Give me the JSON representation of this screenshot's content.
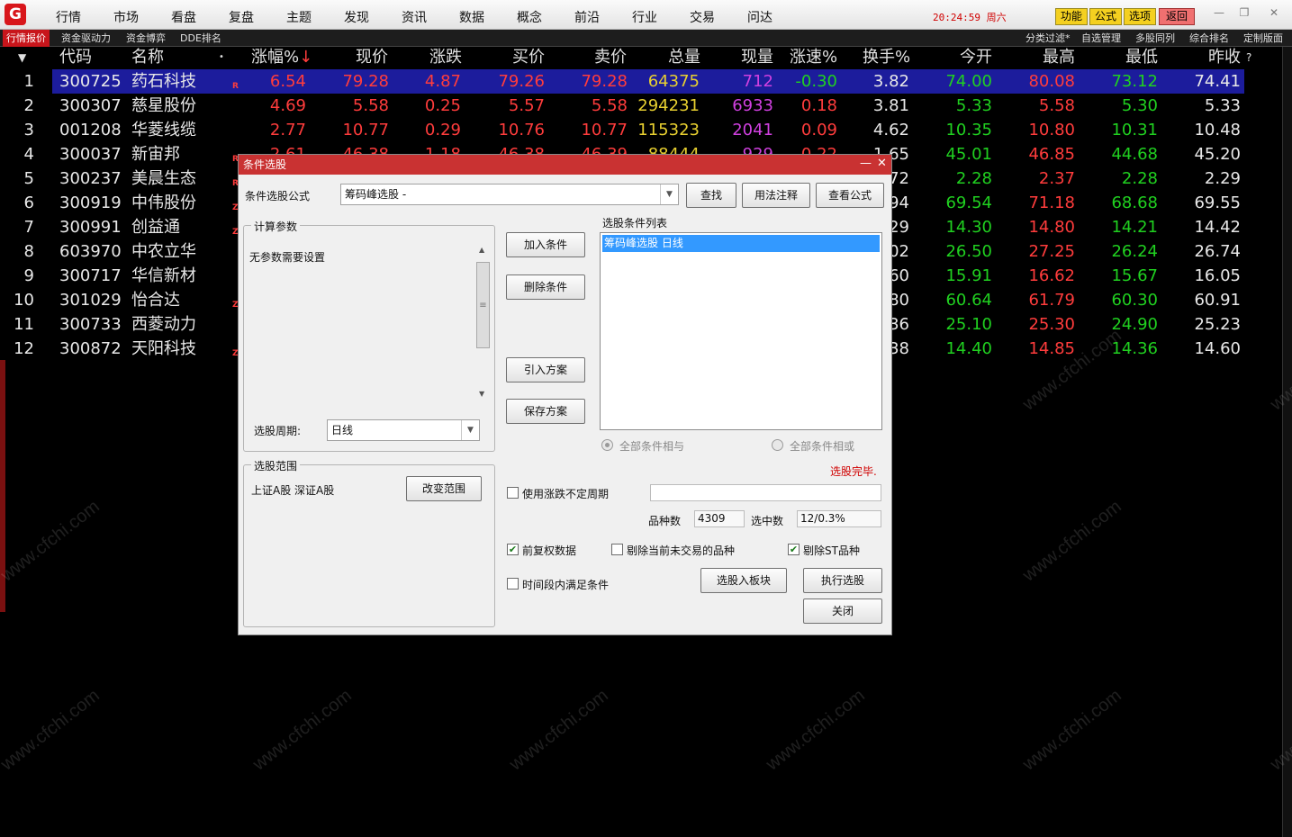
{
  "topbar": {
    "logo": "G",
    "menus": [
      "行情",
      "市场",
      "看盘",
      "复盘",
      "主题",
      "发现",
      "资讯",
      "数据",
      "概念",
      "前沿",
      "行业",
      "交易",
      "问达"
    ],
    "clock": "20:24:59 周六",
    "buttons": [
      {
        "label": "功能",
        "bg": "#f4d020"
      },
      {
        "label": "公式",
        "bg": "#f4d020"
      },
      {
        "label": "选项",
        "bg": "#f4d020"
      },
      {
        "label": "返回",
        "bg": "#f07070"
      }
    ],
    "win": [
      "—",
      "❐",
      "✕"
    ]
  },
  "subtabs": {
    "left": [
      "行情报价",
      "资金驱动力",
      "资金博弈",
      "DDE排名"
    ],
    "right": [
      "分类过滤*",
      "自选管理",
      "多股同列",
      "综合排名",
      "定制版面"
    ]
  },
  "table": {
    "headers": [
      "代码",
      "名称",
      "涨幅%",
      "现价",
      "涨跌",
      "买价",
      "卖价",
      "总量",
      "现量",
      "涨速%",
      "换手%",
      "今开",
      "最高",
      "最低",
      "昨收"
    ],
    "sort_arrow": "↓",
    "help": "?",
    "rows": [
      [
        "1",
        "300725",
        "药石科技",
        "6.54",
        "79.28",
        "4.87",
        "79.26",
        "79.28",
        "64375",
        "712",
        "-0.30",
        "3.82",
        "74.00",
        "80.08",
        "73.12",
        "74.41"
      ],
      [
        "2",
        "300307",
        "慈星股份",
        "4.69",
        "5.58",
        "0.25",
        "5.57",
        "5.58",
        "294231",
        "6933",
        "0.18",
        "3.81",
        "5.33",
        "5.58",
        "5.30",
        "5.33"
      ],
      [
        "3",
        "001208",
        "华菱线缆",
        "2.77",
        "10.77",
        "0.29",
        "10.76",
        "10.77",
        "115323",
        "2041",
        "0.09",
        "4.62",
        "10.35",
        "10.80",
        "10.31",
        "10.48"
      ],
      [
        "4",
        "300037",
        "新宙邦",
        "2.61",
        "46.38",
        "1.18",
        "46.38",
        "46.39",
        "88444",
        "929",
        "0.22",
        "1.65",
        "45.01",
        "46.85",
        "44.68",
        "45.20"
      ],
      [
        "5",
        "300237",
        "美晨生态",
        "",
        "",
        "",
        "",
        "",
        "",
        "",
        "",
        "72",
        "2.28",
        "2.37",
        "2.28",
        "2.29"
      ],
      [
        "6",
        "300919",
        "中伟股份",
        "",
        "",
        "",
        "",
        "",
        "",
        "",
        "",
        "94",
        "69.54",
        "71.18",
        "68.68",
        "69.55"
      ],
      [
        "7",
        "300991",
        "创益通",
        "",
        "",
        "",
        "",
        "",
        "",
        "",
        "",
        "29",
        "14.30",
        "14.80",
        "14.21",
        "14.42"
      ],
      [
        "8",
        "603970",
        "中农立华",
        "",
        "",
        "",
        "",
        "",
        "",
        "",
        "",
        "02",
        "26.50",
        "27.25",
        "26.24",
        "26.74"
      ],
      [
        "9",
        "300717",
        "华信新材",
        "",
        "",
        "",
        "",
        "",
        "",
        "",
        "",
        "60",
        "15.91",
        "16.62",
        "15.67",
        "16.05"
      ],
      [
        "10",
        "301029",
        "怡合达",
        "",
        "",
        "",
        "",
        "",
        "",
        "",
        "",
        "80",
        "60.64",
        "61.79",
        "60.30",
        "60.91"
      ],
      [
        "11",
        "300733",
        "西菱动力",
        "",
        "",
        "",
        "",
        "",
        "",
        "",
        "",
        "36",
        "25.10",
        "25.30",
        "24.90",
        "25.23"
      ],
      [
        "12",
        "300872",
        "天阳科技",
        "",
        "",
        "",
        "",
        "",
        "",
        "",
        "",
        "38",
        "14.40",
        "14.85",
        "14.36",
        "14.60"
      ]
    ]
  },
  "watermark": "www.cfchi.com",
  "dialog": {
    "title": "条件选股",
    "formula_label": "条件选股公式",
    "formula_value": "筹码峰选股   -",
    "btn_find": "查找",
    "btn_usage": "用法注释",
    "btn_view": "查看公式",
    "params_title": "计算参数",
    "params_text": "无参数需要设置",
    "period_label": "选股周期:",
    "period_value": "日线",
    "range_title": "选股范围",
    "range_text": "上证A股 深证A股",
    "btn_change": "改变范围",
    "btn_add": "加入条件",
    "btn_delete": "删除条件",
    "btn_import": "引入方案",
    "btn_save": "保存方案",
    "list_title": "选股条件列表",
    "list_items": [
      "筹码峰选股  日线"
    ],
    "radio_and": "全部条件相与",
    "radio_or": "全部条件相或",
    "status": "选股完毕.",
    "chk_var_period": "使用涨跌不定周期",
    "count_label": "品种数",
    "count_value": "4309",
    "selected_label": "选中数",
    "selected_value": "12/0.3%",
    "chk_fq": "前复权数据",
    "chk_notrade": "剔除当前未交易的品种",
    "chk_st": "剔除ST品种",
    "chk_timerange": "时间段内满足条件",
    "btn_to_block": "选股入板块",
    "btn_run": "执行选股",
    "btn_close": "关闭"
  }
}
